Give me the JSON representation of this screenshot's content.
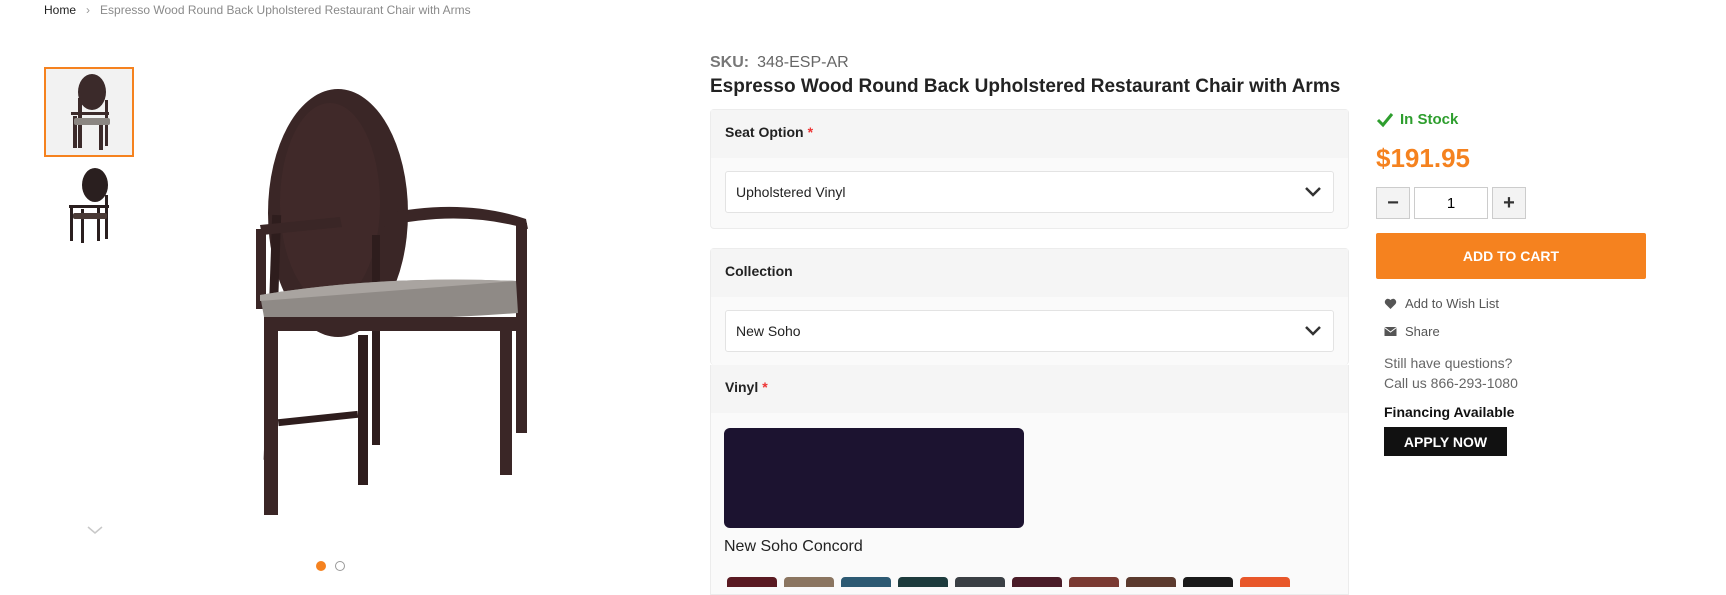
{
  "breadcrumb": {
    "home": "Home",
    "separator": "›",
    "current": "Espresso Wood Round Back Upholstered Restaurant Chair with Arms"
  },
  "gallery": {
    "thumbnails": [
      "chair-front-thumbnail",
      "chair-back-thumbnail"
    ],
    "active_index": 0,
    "dots": 2
  },
  "product": {
    "sku_label": "SKU:",
    "sku": "348-ESP-AR",
    "title": "Espresso Wood Round Back Upholstered Restaurant Chair with Arms"
  },
  "options": {
    "seat": {
      "label": "Seat Option",
      "required": "*",
      "value": "Upholstered Vinyl"
    },
    "collection": {
      "label": "Collection",
      "value": "New Soho"
    },
    "vinyl": {
      "label": "Vinyl",
      "required": "*",
      "selected_name": "New Soho Concord",
      "selected_color": "#1c1330",
      "swatch_colors": [
        "#5a1a22",
        "#8b7560",
        "#2d5a73",
        "#1d3b3d",
        "#3a3f44",
        "#4a1c28",
        "#7a3a32",
        "#5b3a2e",
        "#1a1a1a",
        "#e8572a"
      ]
    }
  },
  "purchase": {
    "stock": "In Stock",
    "price": "$191.95",
    "quantity": "1",
    "minus": "−",
    "plus": "+",
    "add_to_cart": "ADD TO CART",
    "wishlist": "Add to Wish List",
    "share": "Share",
    "questions_line1": "Still have questions?",
    "questions_line2": "Call us 866-293-1080",
    "financing": "Financing Available",
    "apply": "APPLY NOW"
  },
  "colors": {
    "accent": "#f5821f",
    "stock_green": "#2e9e2e"
  }
}
